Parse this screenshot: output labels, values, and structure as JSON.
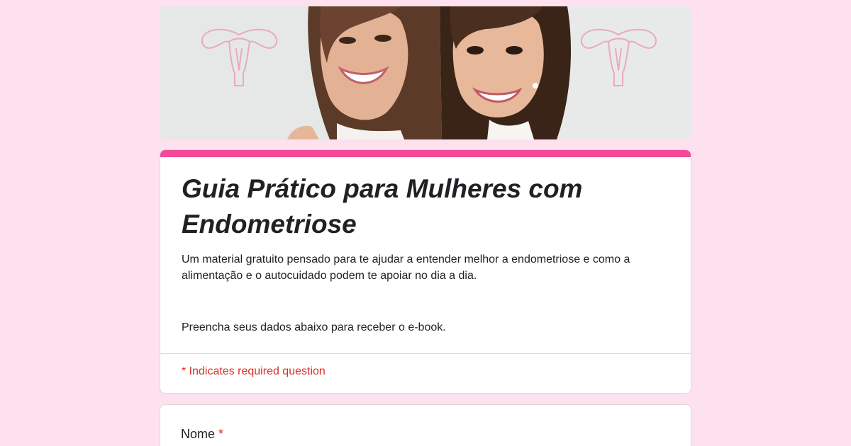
{
  "theme": {
    "background": "#fde1ef",
    "accent": "#f24b9a",
    "required_color": "#d93025"
  },
  "banner": {
    "icons": [
      "uterus-outline-icon",
      "uterus-outline-icon"
    ]
  },
  "form": {
    "title": "Guia Prático para Mulheres com Endometriose",
    "description": "Um material gratuito pensado para te ajudar a entender melhor a endometriose e como a alimentação e o autocuidado podem te apoiar no dia a dia.",
    "instruction": "Preencha seus dados abaixo para receber o e-book.",
    "required_note": "* Indicates required question"
  },
  "questions": [
    {
      "label": "Nome",
      "required_marker": "*"
    }
  ]
}
